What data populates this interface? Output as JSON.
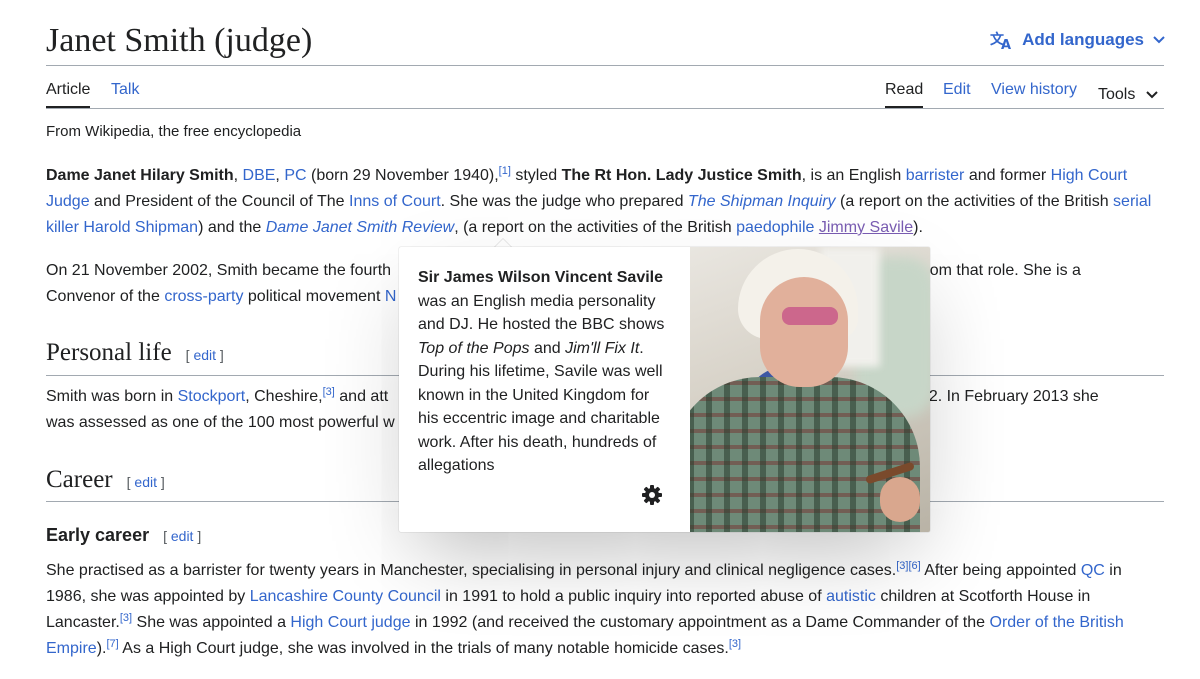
{
  "header": {
    "title": "Janet Smith (judge)",
    "add_languages": "Add languages"
  },
  "tabs": {
    "article": "Article",
    "talk": "Talk",
    "read": "Read",
    "edit": "Edit",
    "view_history": "View history",
    "tools": "Tools"
  },
  "tagline": "From Wikipedia, the free encyclopedia",
  "lead": {
    "name": "Dame Janet Hilary Smith",
    "dbe": "DBE",
    "pc": "PC",
    "born": "(born 29 November 1940),",
    "ref1": "[1]",
    "styled": "styled",
    "style_name": "The Rt Hon. Lady Justice Smith",
    "t1": ", is an English",
    "barrister": "barrister",
    "t2": "and former",
    "high_court_judge": "High Court Judge",
    "t3": "and President of the Council of The",
    "inns_of_court": "Inns of Court",
    "t4": ". She was the judge who prepared",
    "shipman_inquiry": "The Shipman Inquiry",
    "t5": "(a report on the activities of the British",
    "serial_killer": "serial killer",
    "harold_shipman": "Harold Shipman",
    "t6": ") and the",
    "review": "Dame Janet Smith Review",
    "t7": ", (a report on the activities of the British",
    "paedophile": "paedophile",
    "jimmy_savile": "Jimmy Savile",
    "t8": ")."
  },
  "second_para": {
    "line1_start": "On 21 November 2002, Smith became the fourth",
    "line1_end": "from that role. She is a",
    "line2_start": "Convenor of the",
    "cross_party": "cross-party",
    "line2_mid": "political movement",
    "line2_cut": "N"
  },
  "sections": {
    "personal_life": "Personal life",
    "career": "Career",
    "early_career": "Early career",
    "edit": "edit",
    "bracket_open": "[",
    "bracket_close": "]"
  },
  "personal": {
    "l1a": "Smith was born in",
    "stockport": "Stockport",
    "l1b": ", Cheshire,",
    "ref3": "[3]",
    "l1c": "and att",
    "l1d": "1972. In February 2013 she",
    "l2a": "was assessed as one of the 100 most powerful w"
  },
  "early": {
    "s1": "She practised as a barrister for twenty years in Manchester, specialising in personal injury and clinical negligence cases.",
    "ref3": "[3]",
    "ref6": "[6]",
    "s2": "After being appointed",
    "qc": "QC",
    "s3": "in 1986, she was appointed by",
    "lancashire": "Lancashire County Council",
    "s4": "in 1991 to hold a public inquiry into reported abuse of",
    "autistic": "autistic",
    "s5": "children at Scotforth House in Lancaster.",
    "ref3b": "[3]",
    "s6": "She was appointed a",
    "hcj": "High Court judge",
    "s7": "in 1992 (and received the customary appointment as a Dame Commander of the",
    "obe": "Order of the British Empire",
    "s8": ").",
    "ref7": "[7]",
    "s9": "As a High Court judge, she was involved in the trials of many notable homicide cases.",
    "ref3c": "[3]"
  },
  "popup": {
    "name": "Sir James Wilson Vincent Savile",
    "t1": "was an English media personality and DJ. He hosted the BBC shows",
    "totp": "Top of the Pops",
    "and": "and",
    "jfi": "Jim'll Fix It",
    "t2": ". During his lifetime, Savile was well known in the United Kingdom for his eccentric image and charitable work. After his death, hundreds of allegations"
  },
  "icons": {
    "language": "translate-icon",
    "chevron": "chevron-down-icon",
    "settings": "gear-icon"
  },
  "colors": {
    "link": "#3366cc",
    "visited_link": "#795cb2",
    "text": "#202122"
  }
}
